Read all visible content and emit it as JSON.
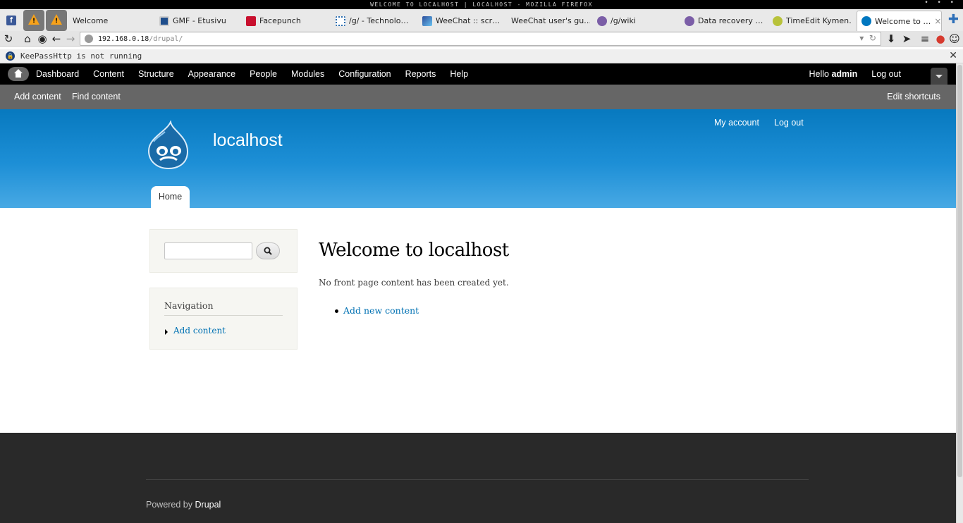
{
  "window": {
    "title": "Welcome to localhost | localhost - Mozilla Firefox",
    "controls": "• • •"
  },
  "tabs": [
    {
      "label": "Welcome",
      "icon": "page-icon"
    },
    {
      "label": "GMF - Etusivu",
      "icon": "gmf-icon"
    },
    {
      "label": "Facepunch",
      "icon": "facepunch-icon"
    },
    {
      "label": "/g/ - Technolo…",
      "icon": "4chan-icon"
    },
    {
      "label": "WeeChat :: scr…",
      "icon": "weechat-icon"
    },
    {
      "label": "WeeChat user's gu…",
      "icon": "page-icon"
    },
    {
      "label": "/g/wiki",
      "icon": "clover-icon"
    },
    {
      "label": "Data recovery …",
      "icon": "clover-icon"
    },
    {
      "label": "TimeEdit Kymen…",
      "icon": "timeedit-icon"
    },
    {
      "label": "Welcome to …",
      "icon": "drupal-icon",
      "active": true,
      "close": "×"
    }
  ],
  "pinned": {
    "warn1": "!",
    "warn2": "!",
    "new_tab": "✚"
  },
  "navbar": {
    "url_host": "192.168.0.18",
    "url_path": "/drupal/",
    "icons": [
      "reload-icon",
      "home-icon",
      "stop-icon",
      "back-icon",
      "forward-icon",
      "download-icon",
      "send-icon",
      "menu-icon",
      "addon-icon",
      "chat-icon"
    ]
  },
  "notification": {
    "text": "KeePassHttp is not running",
    "close": "✕"
  },
  "toolbar": {
    "menu": [
      "Dashboard",
      "Content",
      "Structure",
      "Appearance",
      "People",
      "Modules",
      "Configuration",
      "Reports",
      "Help"
    ],
    "hello": "Hello",
    "user": "admin",
    "logout": "Log out"
  },
  "shortcuts": {
    "add_content": "Add content",
    "find_content": "Find content",
    "edit_shortcuts": "Edit shortcuts"
  },
  "header": {
    "site_name": "localhost",
    "my_account": "My account",
    "log_out": "Log out",
    "home_tab": "Home"
  },
  "sidebar": {
    "search_value": "",
    "nav_title": "Navigation",
    "nav_link": "Add content"
  },
  "main": {
    "title": "Welcome to localhost",
    "message": "No front page content has been created yet.",
    "add_link": "Add new content"
  },
  "footer": {
    "powered_by": "Powered by",
    "drupal": "Drupal"
  },
  "colors": {
    "header_top": "#0779bf",
    "header_bottom": "#48a9e4",
    "link": "#0071b3",
    "footer_bg": "#292929"
  }
}
